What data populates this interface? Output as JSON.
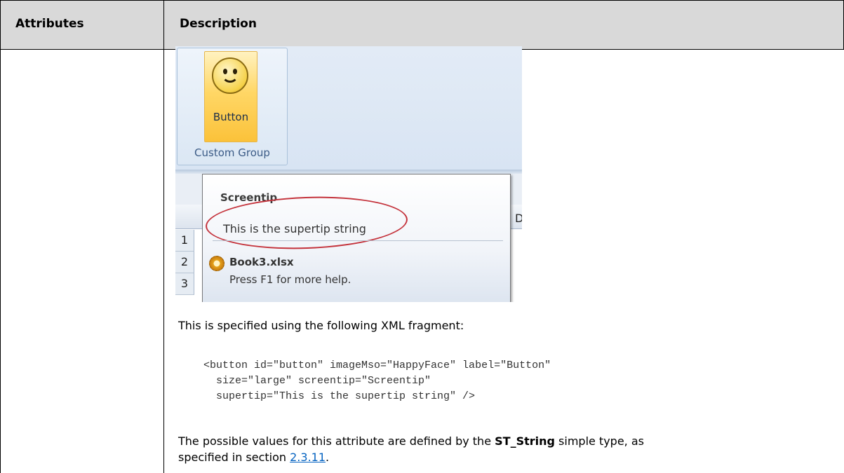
{
  "table": {
    "headers": [
      "Attributes",
      "Description"
    ]
  },
  "figure": {
    "button_label": "Button",
    "group_label": "Custom Group",
    "tooltip": {
      "title": "Screentip",
      "supertip": "This is the supertip string",
      "file_name": "Book3.xlsx",
      "help_text": "Press F1 for more help."
    },
    "column_header_visible": "D",
    "row_numbers": [
      "1",
      "2",
      "3"
    ]
  },
  "content": {
    "intro": "This is specified using the following XML fragment:",
    "code_lines": [
      "<button id=\"button\" imageMso=\"HappyFace\" label=\"Button\"",
      "  size=\"large\" screentip=\"Screentip\"",
      "  supertip=\"This is the supertip string\" />"
    ],
    "possible_values_prefix": "The possible values for this attribute are defined by the ",
    "type_name": "ST_String",
    "possible_values_suffix": " simple type, as",
    "line2_prefix": "specified in section ",
    "section_link": "2.3.11",
    "line2_suffix": "."
  },
  "colors": {
    "header_bg": "#d9d9d9",
    "link": "#0563c1",
    "ellipse": "#c4323b",
    "button_highlight": "#ffd766"
  }
}
